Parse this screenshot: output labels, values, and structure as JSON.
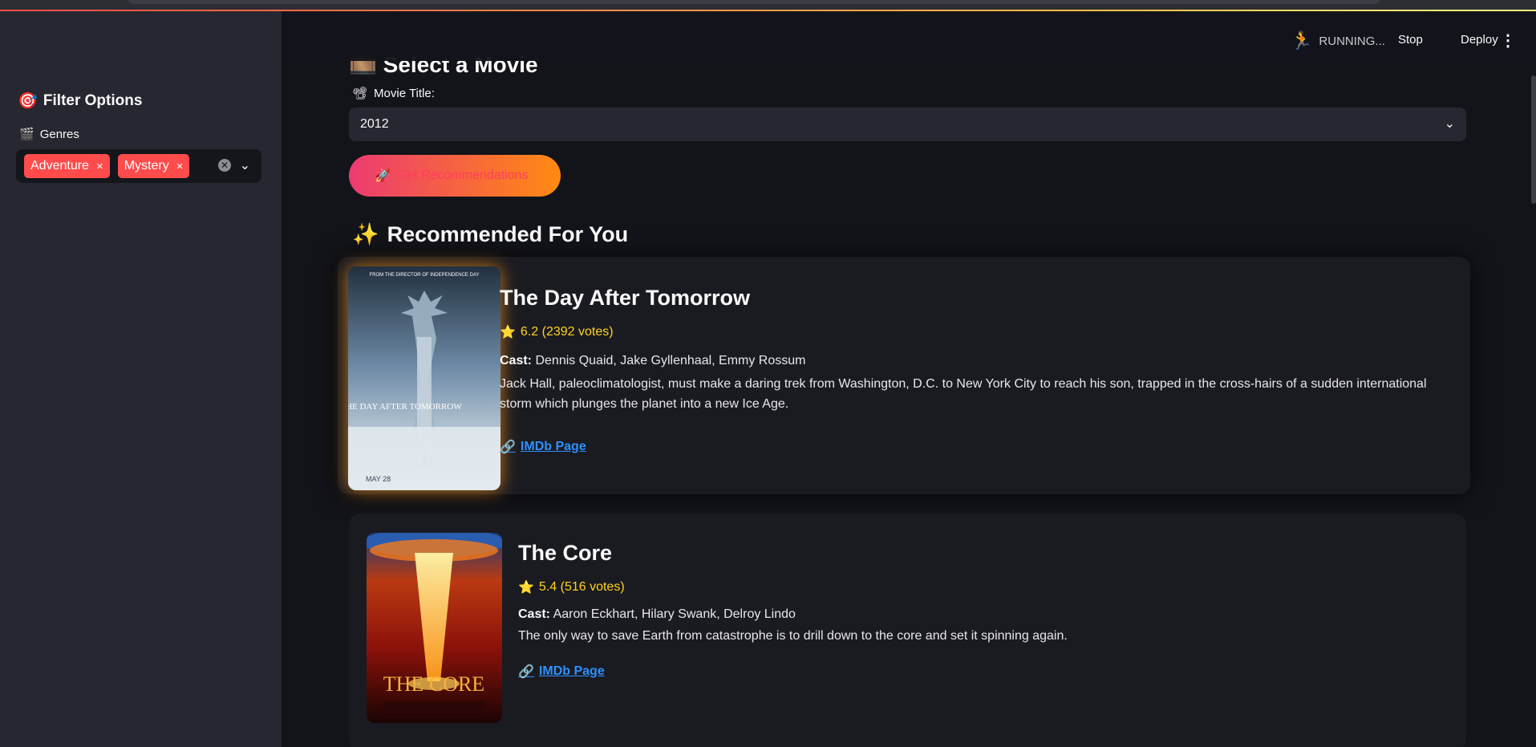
{
  "sidebar": {
    "title": "Filter Options",
    "title_icon": "🎯",
    "genres_label": "Genres",
    "genres_icon": "🎬",
    "selected_genres": [
      "Adventure",
      "Mystery"
    ],
    "chip_close": "×",
    "clear_symbol": "✕",
    "dropdown_symbol": "⌄"
  },
  "header": {
    "status": "RUNNING...",
    "stop_label": "Stop",
    "deploy_label": "Deploy",
    "menu_symbol": "⋮"
  },
  "main": {
    "section_title_cut": "🎞️ Select a Movie",
    "movie_label": "Movie Title:",
    "movie_label_icon": "📽",
    "selected_movie": "2012",
    "select_chevron": "⌄",
    "button_icon": "🚀",
    "button_label": "Get Recommendations",
    "rec_icon": "✨",
    "rec_title": "Recommended For You"
  },
  "movies": [
    {
      "title": "The Day After Tomorrow",
      "rating_icon": "⭐",
      "rating": "6.2 (2392 votes)",
      "cast_label": "Cast:",
      "cast": " Dennis Quaid, Jake Gyllenhaal, Emmy Rossum",
      "description": "Jack Hall, paleoclimatologist, must make a daring trek from Washington, D.C. to New York City to reach his son, trapped in the cross-hairs of a sudden international storm which plunges the planet into a new Ice Age.",
      "link_icon": "🔗",
      "link_label": "IMDb Page",
      "poster_top_text": "FROM THE DIRECTOR OF INDEPENDENCE DAY",
      "poster_title": "THE DAY AFTER TOMORROW",
      "poster_date": "MAY 28"
    },
    {
      "title": "The Core",
      "rating_icon": "⭐",
      "rating": "5.4 (516 votes)",
      "cast_label": "Cast:",
      "cast": " Aaron Eckhart, Hilary Swank, Delroy Lindo",
      "description": "The only way to save Earth from catastrophe is to drill down to the core and set it spinning again.",
      "link_icon": "🔗",
      "link_label": "IMDb Page",
      "poster_title": "THE CORE"
    }
  ],
  "colors": {
    "accent": "#ff4b4b",
    "rating": "#ffd21e",
    "link": "#2e90ff",
    "button_gradient_start": "#ec3b71",
    "button_gradient_end": "#ff8a12"
  }
}
